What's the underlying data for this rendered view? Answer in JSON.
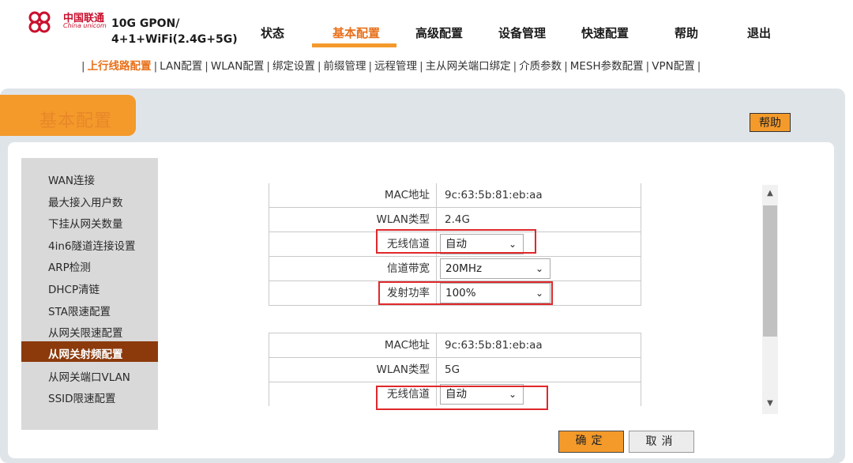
{
  "brand": {
    "logo_cn": "中国联通",
    "logo_en": "China unicom",
    "model_line1": "10G GPON/",
    "model_line2": "4+1+WiFi(2.4G+5G)",
    "accent": "#f39a2b",
    "brand_red": "#c8102e"
  },
  "nav": {
    "items": [
      "状态",
      "基本配置",
      "高级配置",
      "设备管理",
      "快速配置",
      "帮助",
      "退出"
    ],
    "active": "基本配置"
  },
  "subnav": {
    "items": [
      "上行线路配置",
      "LAN配置",
      "WLAN配置",
      "绑定设置",
      "前缀管理",
      "远程管理",
      "主从网关端口绑定",
      "介质参数",
      "MESH参数配置",
      "VPN配置"
    ],
    "active": "上行线路配置"
  },
  "panel": {
    "title": "基本配置",
    "help_label": "帮助"
  },
  "sidebar": {
    "items": [
      "WAN连接",
      "最大接入用户数",
      "下挂从网关数量",
      "4in6隧道连接设置",
      "ARP检测",
      "DHCP清链",
      "STA限速配置",
      "从网关限速配置",
      "从网关射频配置",
      "从网关端口VLAN",
      "SSID限速配置"
    ],
    "active": "从网关射频配置"
  },
  "form": {
    "group1": {
      "mac_label": "MAC地址",
      "mac_value": "9c:63:5b:81:eb:aa",
      "wlan_type_label": "WLAN类型",
      "wlan_type_value": "2.4G",
      "channel_label": "无线信道",
      "channel_value": "自动",
      "bandwidth_label": "信道带宽",
      "bandwidth_value": "20MHz",
      "power_label": "发射功率",
      "power_value": "100%"
    },
    "group2": {
      "mac_label": "MAC地址",
      "mac_value": "9c:63:5b:81:eb:aa",
      "wlan_type_label": "WLAN类型",
      "wlan_type_value": "5G",
      "channel_label": "无线信道",
      "channel_value": "自动"
    },
    "highlight_color": "#e0282a"
  },
  "actions": {
    "ok_label": "确定",
    "cancel_label": "取消"
  },
  "icons": {
    "dropdown": "chevron-down-icon",
    "scroll_up": "arrow-up-icon",
    "scroll_down": "arrow-down-icon",
    "logo": "china-unicom-knot-logo"
  }
}
